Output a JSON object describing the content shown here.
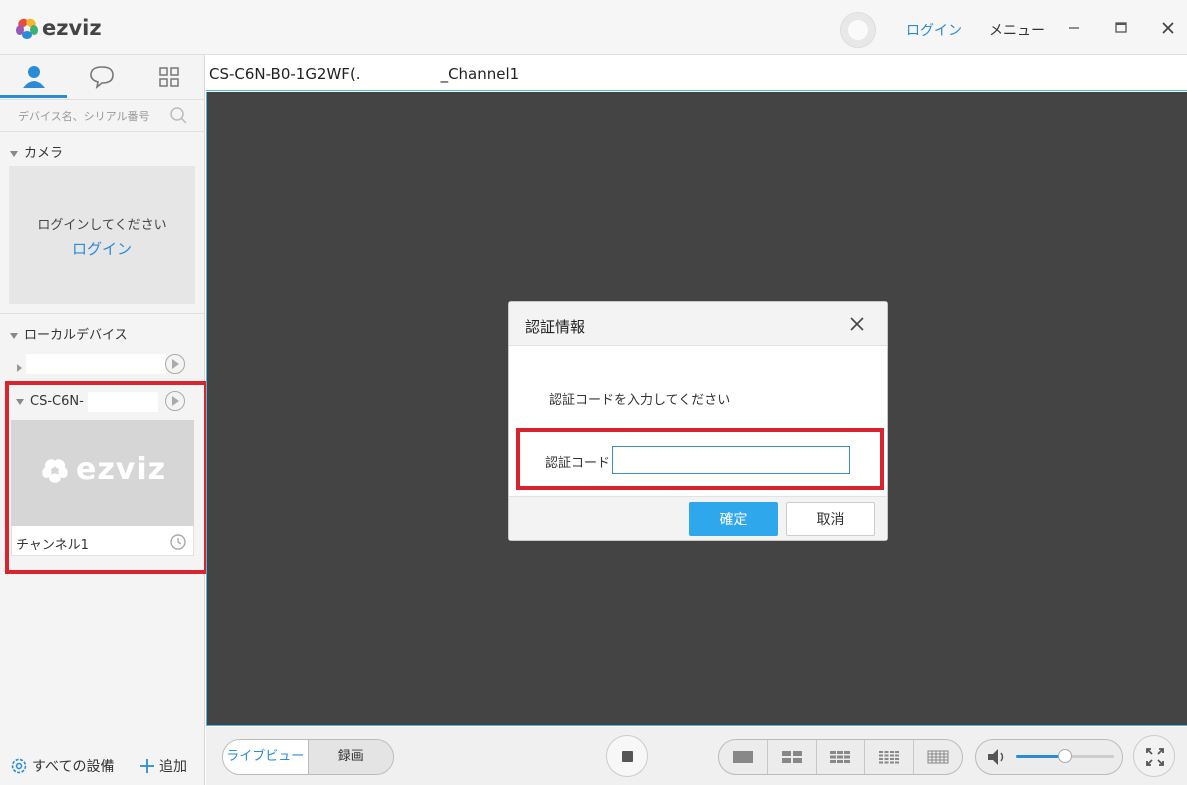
{
  "header": {
    "logo_text": "ezviz",
    "login": "ログイン",
    "menu": "メニュー",
    "minimize": "−",
    "maximize": "□",
    "close": "×"
  },
  "sidebar": {
    "search_placeholder": "デバイス名、シリアル番号",
    "camera_section": "カメラ",
    "camera_prompt": "ログインしてください",
    "camera_login": "ログイン",
    "local_section": "ローカルデバイス",
    "device_name": "CS-C6N-",
    "thumb_logo": "ezviz",
    "channel": "チャンネル1",
    "all_devices": "すべての設備",
    "add": "追加"
  },
  "main": {
    "title_prefix": "CS-C6N-B0-1G2WF(.",
    "title_suffix": "_Channel1"
  },
  "dialog": {
    "title": "認証情報",
    "message": "認証コードを入力してください",
    "code_label": "認証コード",
    "code_value": "",
    "ok": "確定",
    "cancel": "取消"
  },
  "toolbar": {
    "live_view": "ライブビュー",
    "recording": "録画",
    "volume_level": 0.5
  },
  "colors": {
    "accent": "#2a8bd8",
    "highlight": "#d9232d",
    "primary_button": "#2fa7ec",
    "viewport": "#444444"
  }
}
